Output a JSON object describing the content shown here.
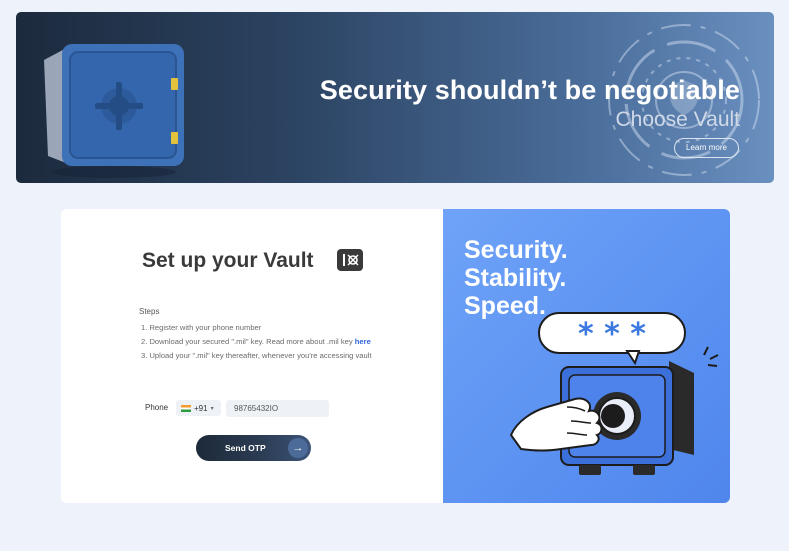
{
  "banner": {
    "title": "Security shouldn’t be negotiable",
    "subtitle": "Choose Vault",
    "learn_more": "Learn more"
  },
  "setup": {
    "title": "Set up your Vault",
    "steps_heading": "Steps",
    "steps": [
      "1. Register with your phone number",
      "2. Download your secured \".mil\" key. Read more about .mil key ",
      "3. Upload your \".mil\" key thereafter, whenever you're accessing vault"
    ],
    "here_link": "here",
    "phone_label": "Phone",
    "country_code": "+91",
    "phone_value": "98765432IO",
    "send_label": "Send OTP"
  },
  "promo": {
    "line1": "Security.",
    "line2": "Stability.",
    "line3": "Speed.",
    "bubble_text": "* * *"
  },
  "colors": {
    "accent_blue": "#5b91f1",
    "dark_navy": "#1d2a3a",
    "link": "#2f63d6"
  }
}
